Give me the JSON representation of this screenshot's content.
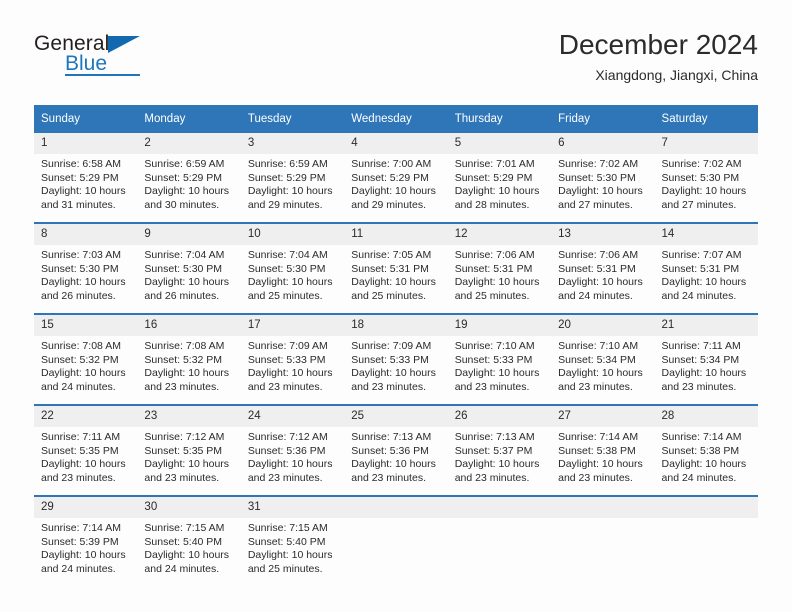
{
  "brand": {
    "name_top": "General",
    "name_bottom": "Blue",
    "accent_color": "#1e76bd",
    "triangle_color": "#1269b0"
  },
  "header": {
    "title": "December 2024",
    "subtitle": "Xiangdong, Jiangxi, China"
  },
  "calendar": {
    "header_bg": "#2e76b8",
    "daynum_bg": "#efefef",
    "weekday_headers": [
      "Sunday",
      "Monday",
      "Tuesday",
      "Wednesday",
      "Thursday",
      "Friday",
      "Saturday"
    ],
    "weeks": [
      [
        {
          "day": "1",
          "sunrise": "Sunrise: 6:58 AM",
          "sunset": "Sunset: 5:29 PM",
          "daylight_line1": "Daylight: 10 hours",
          "daylight_line2": "and 31 minutes."
        },
        {
          "day": "2",
          "sunrise": "Sunrise: 6:59 AM",
          "sunset": "Sunset: 5:29 PM",
          "daylight_line1": "Daylight: 10 hours",
          "daylight_line2": "and 30 minutes."
        },
        {
          "day": "3",
          "sunrise": "Sunrise: 6:59 AM",
          "sunset": "Sunset: 5:29 PM",
          "daylight_line1": "Daylight: 10 hours",
          "daylight_line2": "and 29 minutes."
        },
        {
          "day": "4",
          "sunrise": "Sunrise: 7:00 AM",
          "sunset": "Sunset: 5:29 PM",
          "daylight_line1": "Daylight: 10 hours",
          "daylight_line2": "and 29 minutes."
        },
        {
          "day": "5",
          "sunrise": "Sunrise: 7:01 AM",
          "sunset": "Sunset: 5:29 PM",
          "daylight_line1": "Daylight: 10 hours",
          "daylight_line2": "and 28 minutes."
        },
        {
          "day": "6",
          "sunrise": "Sunrise: 7:02 AM",
          "sunset": "Sunset: 5:30 PM",
          "daylight_line1": "Daylight: 10 hours",
          "daylight_line2": "and 27 minutes."
        },
        {
          "day": "7",
          "sunrise": "Sunrise: 7:02 AM",
          "sunset": "Sunset: 5:30 PM",
          "daylight_line1": "Daylight: 10 hours",
          "daylight_line2": "and 27 minutes."
        }
      ],
      [
        {
          "day": "8",
          "sunrise": "Sunrise: 7:03 AM",
          "sunset": "Sunset: 5:30 PM",
          "daylight_line1": "Daylight: 10 hours",
          "daylight_line2": "and 26 minutes."
        },
        {
          "day": "9",
          "sunrise": "Sunrise: 7:04 AM",
          "sunset": "Sunset: 5:30 PM",
          "daylight_line1": "Daylight: 10 hours",
          "daylight_line2": "and 26 minutes."
        },
        {
          "day": "10",
          "sunrise": "Sunrise: 7:04 AM",
          "sunset": "Sunset: 5:30 PM",
          "daylight_line1": "Daylight: 10 hours",
          "daylight_line2": "and 25 minutes."
        },
        {
          "day": "11",
          "sunrise": "Sunrise: 7:05 AM",
          "sunset": "Sunset: 5:31 PM",
          "daylight_line1": "Daylight: 10 hours",
          "daylight_line2": "and 25 minutes."
        },
        {
          "day": "12",
          "sunrise": "Sunrise: 7:06 AM",
          "sunset": "Sunset: 5:31 PM",
          "daylight_line1": "Daylight: 10 hours",
          "daylight_line2": "and 25 minutes."
        },
        {
          "day": "13",
          "sunrise": "Sunrise: 7:06 AM",
          "sunset": "Sunset: 5:31 PM",
          "daylight_line1": "Daylight: 10 hours",
          "daylight_line2": "and 24 minutes."
        },
        {
          "day": "14",
          "sunrise": "Sunrise: 7:07 AM",
          "sunset": "Sunset: 5:31 PM",
          "daylight_line1": "Daylight: 10 hours",
          "daylight_line2": "and 24 minutes."
        }
      ],
      [
        {
          "day": "15",
          "sunrise": "Sunrise: 7:08 AM",
          "sunset": "Sunset: 5:32 PM",
          "daylight_line1": "Daylight: 10 hours",
          "daylight_line2": "and 24 minutes."
        },
        {
          "day": "16",
          "sunrise": "Sunrise: 7:08 AM",
          "sunset": "Sunset: 5:32 PM",
          "daylight_line1": "Daylight: 10 hours",
          "daylight_line2": "and 23 minutes."
        },
        {
          "day": "17",
          "sunrise": "Sunrise: 7:09 AM",
          "sunset": "Sunset: 5:33 PM",
          "daylight_line1": "Daylight: 10 hours",
          "daylight_line2": "and 23 minutes."
        },
        {
          "day": "18",
          "sunrise": "Sunrise: 7:09 AM",
          "sunset": "Sunset: 5:33 PM",
          "daylight_line1": "Daylight: 10 hours",
          "daylight_line2": "and 23 minutes."
        },
        {
          "day": "19",
          "sunrise": "Sunrise: 7:10 AM",
          "sunset": "Sunset: 5:33 PM",
          "daylight_line1": "Daylight: 10 hours",
          "daylight_line2": "and 23 minutes."
        },
        {
          "day": "20",
          "sunrise": "Sunrise: 7:10 AM",
          "sunset": "Sunset: 5:34 PM",
          "daylight_line1": "Daylight: 10 hours",
          "daylight_line2": "and 23 minutes."
        },
        {
          "day": "21",
          "sunrise": "Sunrise: 7:11 AM",
          "sunset": "Sunset: 5:34 PM",
          "daylight_line1": "Daylight: 10 hours",
          "daylight_line2": "and 23 minutes."
        }
      ],
      [
        {
          "day": "22",
          "sunrise": "Sunrise: 7:11 AM",
          "sunset": "Sunset: 5:35 PM",
          "daylight_line1": "Daylight: 10 hours",
          "daylight_line2": "and 23 minutes."
        },
        {
          "day": "23",
          "sunrise": "Sunrise: 7:12 AM",
          "sunset": "Sunset: 5:35 PM",
          "daylight_line1": "Daylight: 10 hours",
          "daylight_line2": "and 23 minutes."
        },
        {
          "day": "24",
          "sunrise": "Sunrise: 7:12 AM",
          "sunset": "Sunset: 5:36 PM",
          "daylight_line1": "Daylight: 10 hours",
          "daylight_line2": "and 23 minutes."
        },
        {
          "day": "25",
          "sunrise": "Sunrise: 7:13 AM",
          "sunset": "Sunset: 5:36 PM",
          "daylight_line1": "Daylight: 10 hours",
          "daylight_line2": "and 23 minutes."
        },
        {
          "day": "26",
          "sunrise": "Sunrise: 7:13 AM",
          "sunset": "Sunset: 5:37 PM",
          "daylight_line1": "Daylight: 10 hours",
          "daylight_line2": "and 23 minutes."
        },
        {
          "day": "27",
          "sunrise": "Sunrise: 7:14 AM",
          "sunset": "Sunset: 5:38 PM",
          "daylight_line1": "Daylight: 10 hours",
          "daylight_line2": "and 23 minutes."
        },
        {
          "day": "28",
          "sunrise": "Sunrise: 7:14 AM",
          "sunset": "Sunset: 5:38 PM",
          "daylight_line1": "Daylight: 10 hours",
          "daylight_line2": "and 24 minutes."
        }
      ],
      [
        {
          "day": "29",
          "sunrise": "Sunrise: 7:14 AM",
          "sunset": "Sunset: 5:39 PM",
          "daylight_line1": "Daylight: 10 hours",
          "daylight_line2": "and 24 minutes."
        },
        {
          "day": "30",
          "sunrise": "Sunrise: 7:15 AM",
          "sunset": "Sunset: 5:40 PM",
          "daylight_line1": "Daylight: 10 hours",
          "daylight_line2": "and 24 minutes."
        },
        {
          "day": "31",
          "sunrise": "Sunrise: 7:15 AM",
          "sunset": "Sunset: 5:40 PM",
          "daylight_line1": "Daylight: 10 hours",
          "daylight_line2": "and 25 minutes."
        },
        {
          "day": "",
          "sunrise": "",
          "sunset": "",
          "daylight_line1": "",
          "daylight_line2": ""
        },
        {
          "day": "",
          "sunrise": "",
          "sunset": "",
          "daylight_line1": "",
          "daylight_line2": ""
        },
        {
          "day": "",
          "sunrise": "",
          "sunset": "",
          "daylight_line1": "",
          "daylight_line2": ""
        },
        {
          "day": "",
          "sunrise": "",
          "sunset": "",
          "daylight_line1": "",
          "daylight_line2": ""
        }
      ]
    ]
  }
}
